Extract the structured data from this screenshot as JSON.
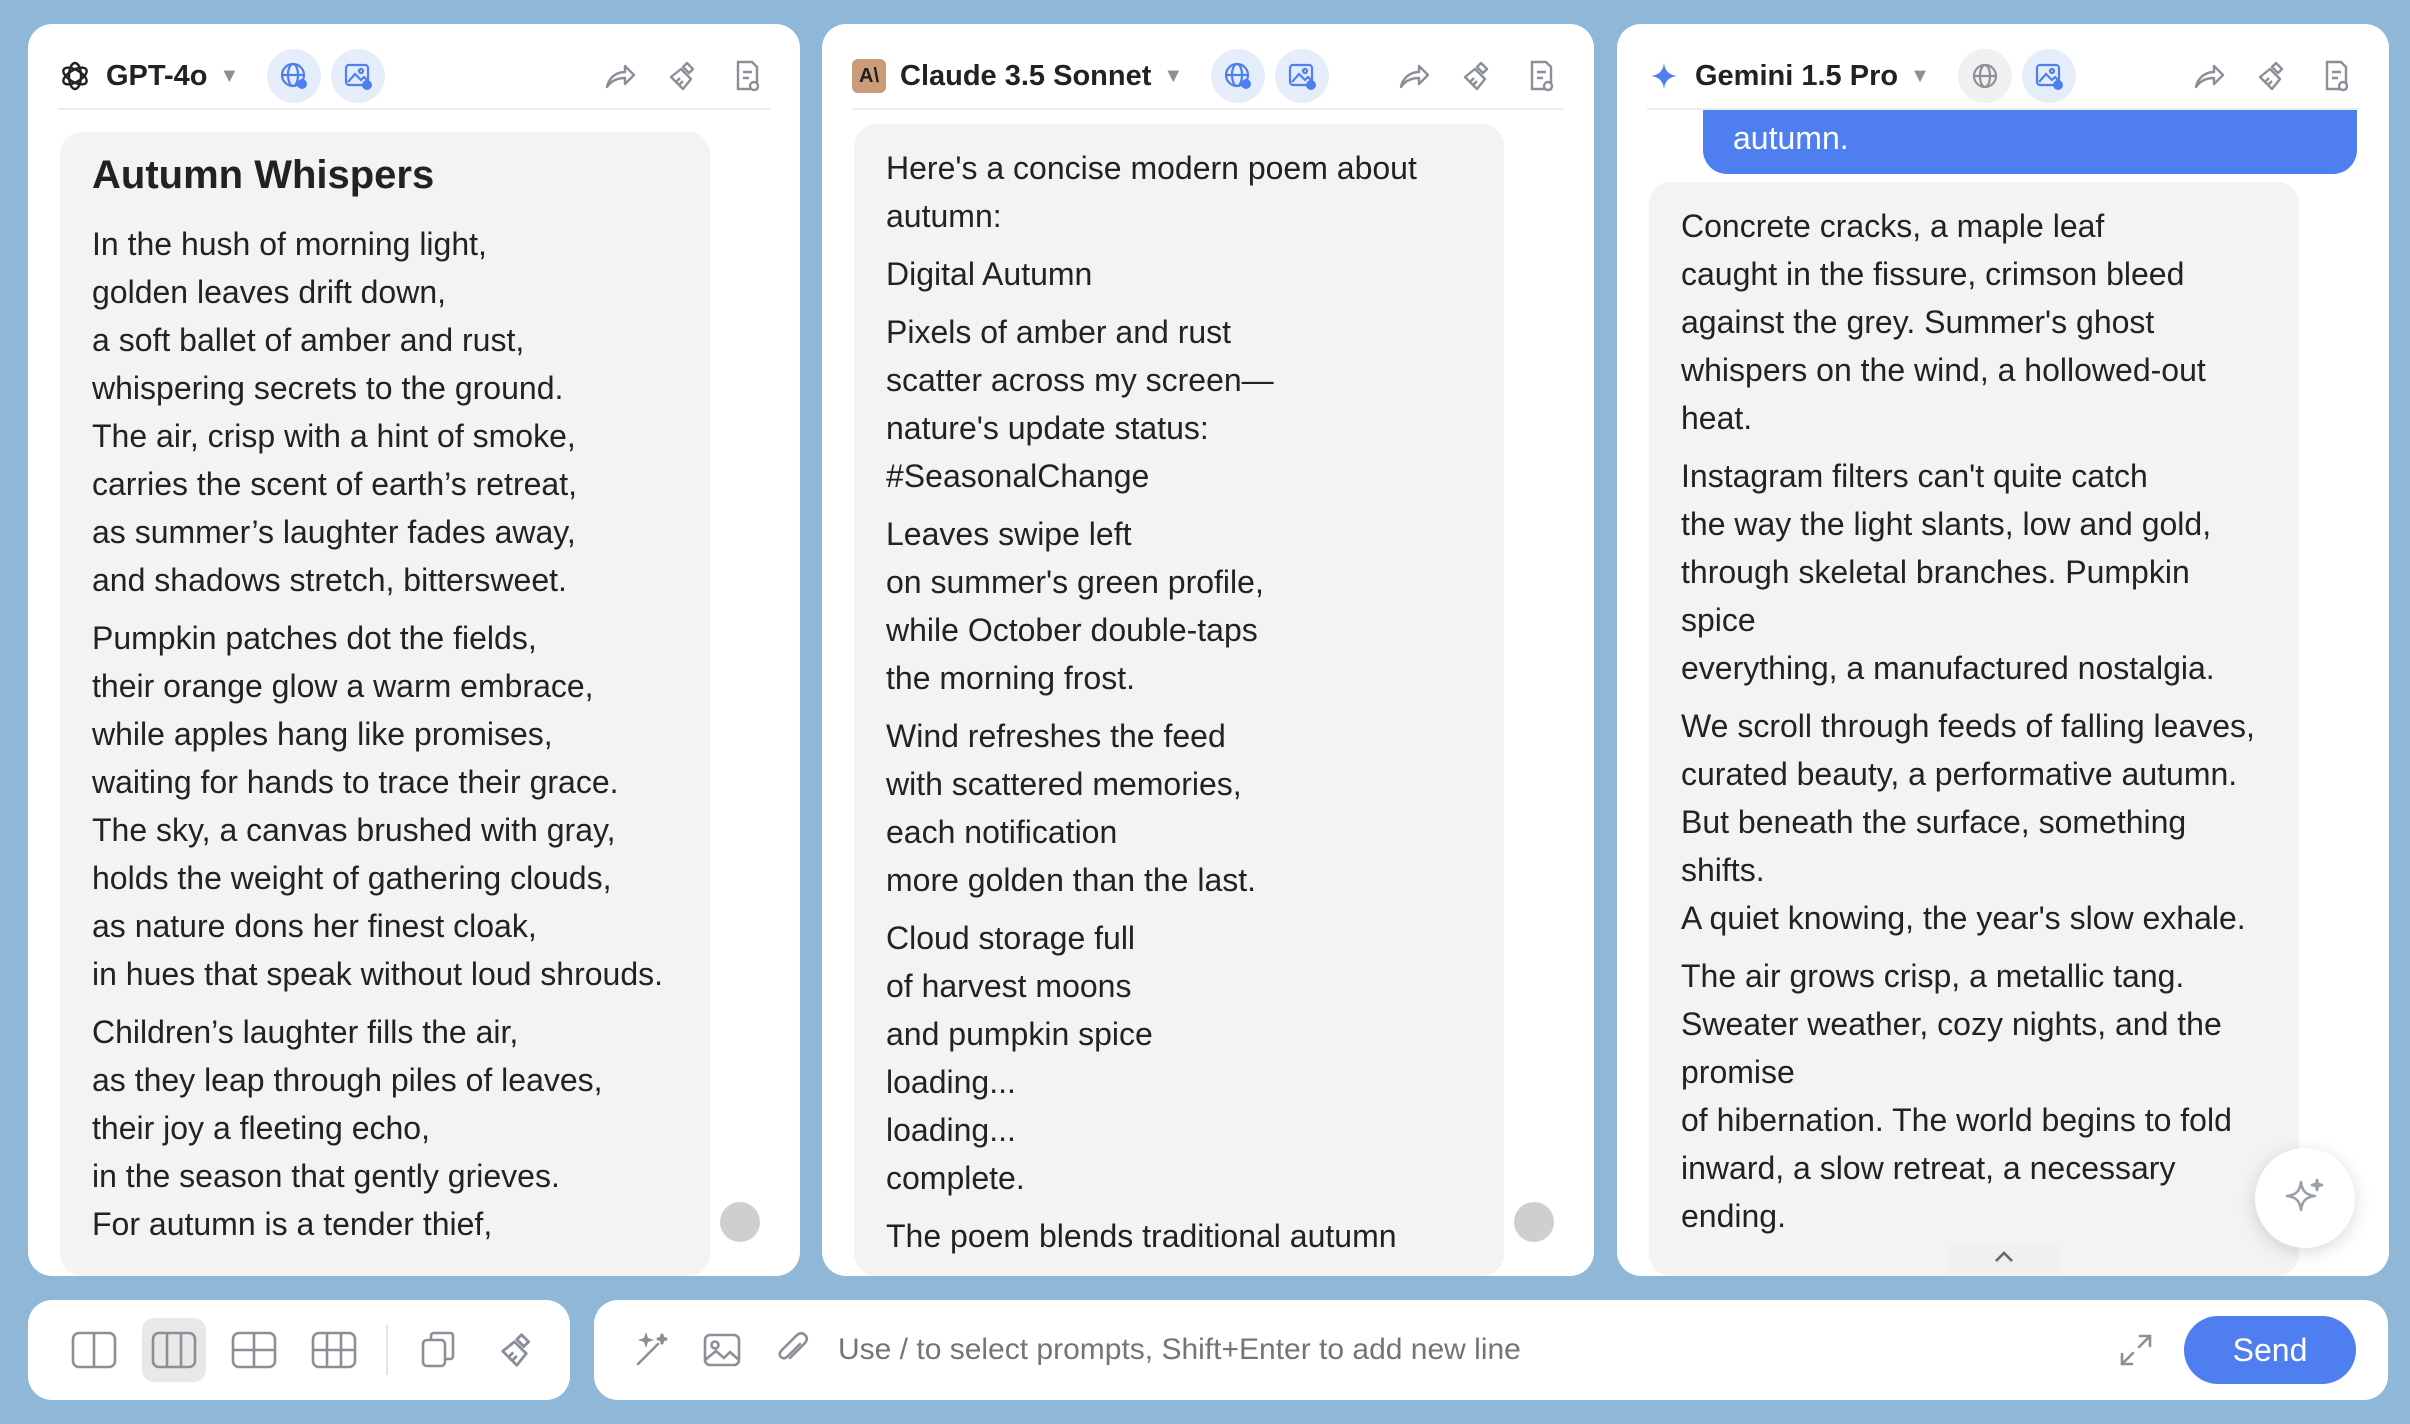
{
  "panels": [
    {
      "model": "GPT-4o",
      "message": {
        "title": "Autumn Whispers",
        "paragraphs": [
          [
            "In the hush of morning light,",
            "golden leaves drift down,",
            "a soft ballet of amber and rust,",
            "whispering secrets to the ground.",
            "The air, crisp with a hint of smoke,",
            "carries the scent of earth’s retreat,",
            "as summer’s laughter fades away,",
            "and shadows stretch, bittersweet."
          ],
          [
            "Pumpkin patches dot the fields,",
            "their orange glow a warm embrace,",
            "while apples hang like promises,",
            "waiting for hands to trace their grace.",
            "The sky, a canvas brushed with gray,",
            "holds the weight of gathering clouds,",
            "as nature dons her finest cloak,",
            "in hues that speak without loud shrouds."
          ],
          [
            "Children’s laughter fills the air,",
            "as they leap through piles of leaves,",
            "their joy a fleeting echo,",
            "in the season that gently grieves.",
            "For autumn is a tender thief,"
          ]
        ]
      }
    },
    {
      "model": "Claude 3.5 Sonnet",
      "logo_text": "A\\",
      "message": {
        "paragraphs": [
          [
            "Here's a concise modern poem about",
            "autumn:"
          ],
          [
            "Digital Autumn"
          ],
          [
            "Pixels of amber and rust",
            "scatter across my screen—",
            "nature's update status:",
            "#SeasonalChange"
          ],
          [
            "Leaves swipe left",
            "on summer's green profile,",
            "while October double-taps",
            "the morning frost."
          ],
          [
            "Wind refreshes the feed",
            "with scattered memories,",
            "each notification",
            "more golden than the last."
          ],
          [
            "Cloud storage full",
            "of harvest moons",
            "and pumpkin spice",
            "loading...",
            "loading...",
            "complete."
          ],
          [
            "The poem blends traditional autumn"
          ]
        ]
      }
    },
    {
      "model": "Gemini 1.5 Pro",
      "user_message_tail": "autumn.",
      "message": {
        "paragraphs": [
          [
            "Concrete cracks, a maple leaf",
            "caught in the fissure, crimson bleed",
            "against the grey. Summer's ghost",
            "whispers on the wind, a hollowed-out",
            "heat."
          ],
          [
            "Instagram filters can't quite catch",
            "the way the light slants, low and gold,",
            "through skeletal branches. Pumpkin",
            "spice",
            "everything, a manufactured nostalgia."
          ],
          [
            "We scroll through feeds of falling leaves,",
            "curated beauty, a performative autumn.",
            "But beneath the surface, something",
            "shifts.",
            "A quiet knowing, the year's slow exhale."
          ],
          [
            "The air grows crisp, a metallic tang.",
            "Sweater weather, cozy nights, and the",
            "promise",
            "of hibernation. The world begins to fold",
            "inward, a slow retreat, a necessary",
            "ending."
          ]
        ]
      }
    }
  ],
  "input": {
    "placeholder": "Use / to select prompts, Shift+Enter to add new line",
    "send_label": "Send"
  },
  "colors": {
    "accent": "#4f7ef0",
    "background": "#8fb8d8",
    "bubble": "#f3f3f3"
  }
}
